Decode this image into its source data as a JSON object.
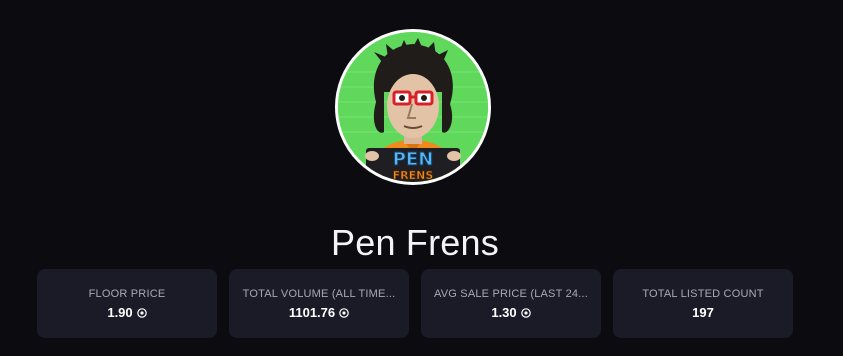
{
  "collection": {
    "name": "Pen Frens",
    "avatar_text_top": "PEN",
    "avatar_text_bottom": "FRENS"
  },
  "stats": [
    {
      "label": "FLOOR PRICE",
      "value": "1.90",
      "icon": "currency-icon"
    },
    {
      "label": "TOTAL VOLUME (ALL TIME...",
      "value": "1101.76",
      "icon": "currency-icon"
    },
    {
      "label": "AVG SALE PRICE (LAST 24...",
      "value": "1.30",
      "icon": "currency-icon"
    },
    {
      "label": "TOTAL LISTED COUNT",
      "value": "197",
      "icon": ""
    }
  ],
  "colors": {
    "background": "#0c0b10",
    "card": "#1b1a27",
    "label": "#a9a8b5",
    "avatar_bg": "#5fd85b",
    "avatar_shirt": "#f08a1c",
    "avatar_text_blue": "#5ab4f2"
  }
}
